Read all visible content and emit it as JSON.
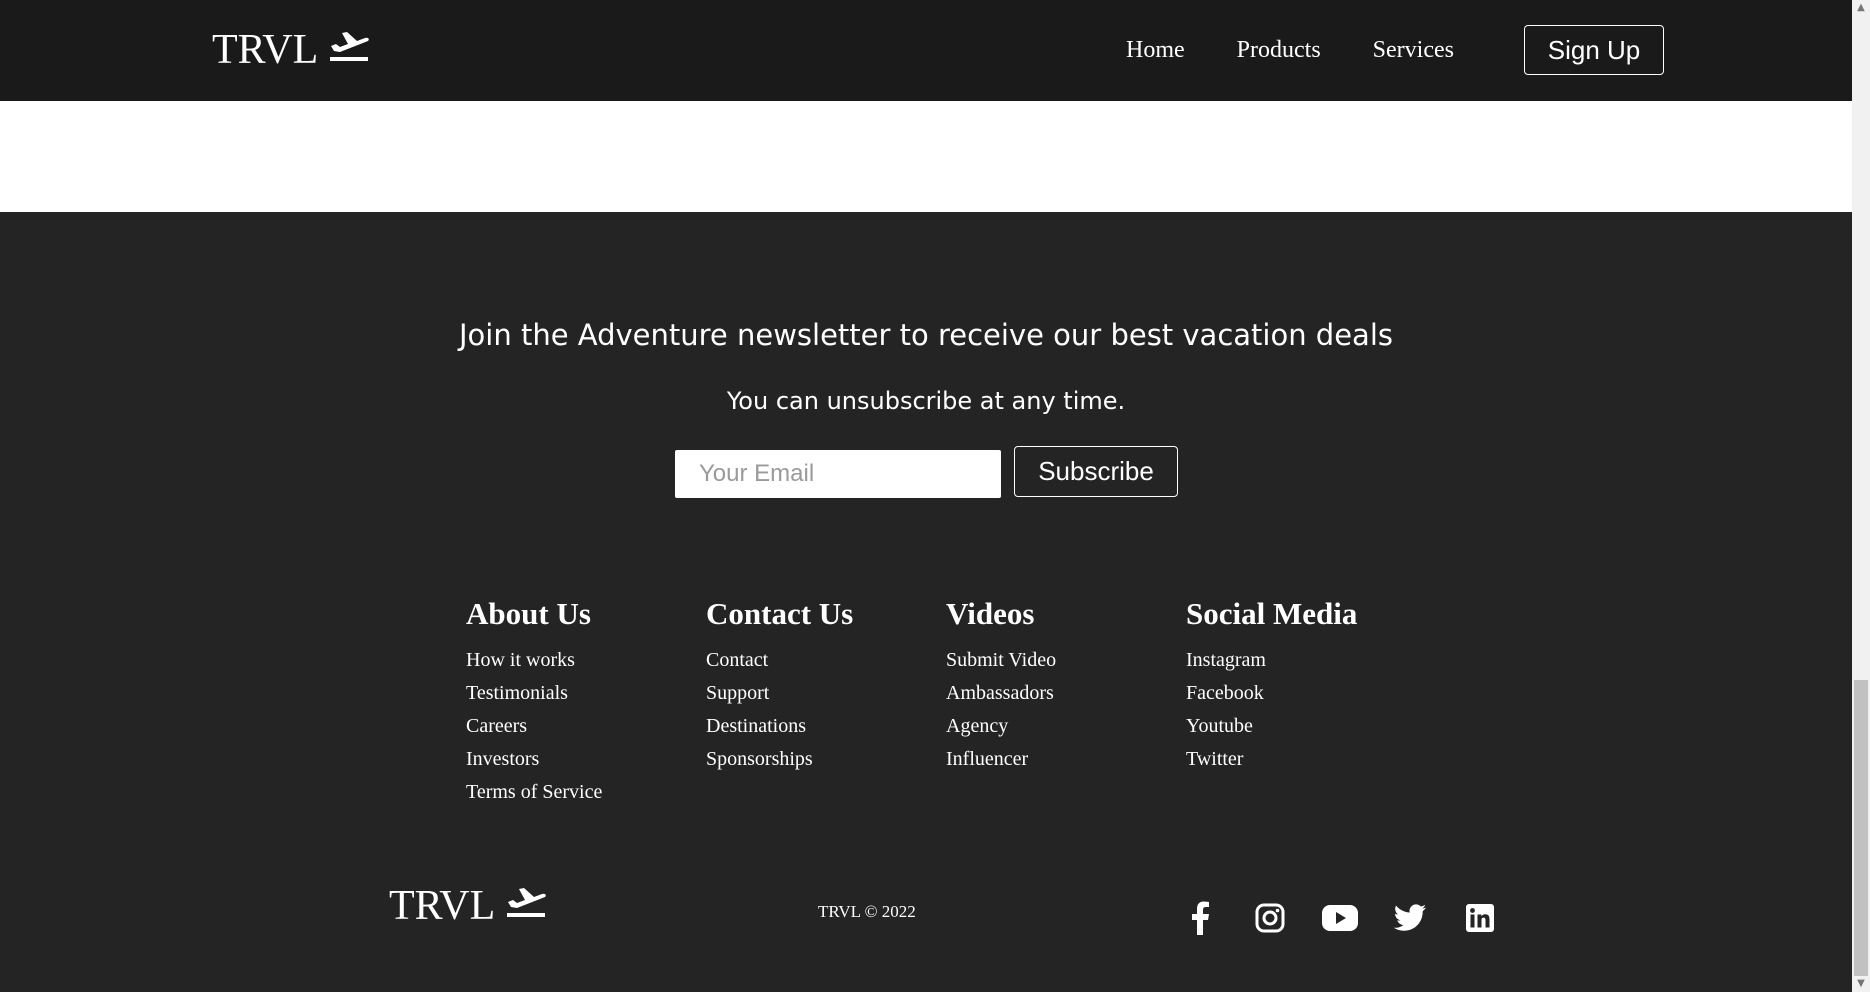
{
  "nav": {
    "logo_text": "TRVL",
    "links": [
      "Home",
      "Products",
      "Services"
    ],
    "signup_label": "Sign Up"
  },
  "newsletter": {
    "heading": "Join the Adventure newsletter to receive our best vacation deals",
    "subtext": "You can unsubscribe at any time.",
    "email_placeholder": "Your Email",
    "subscribe_label": "Subscribe"
  },
  "footer_columns": [
    {
      "title": "About Us",
      "links": [
        "How it works",
        "Testimonials",
        "Careers",
        "Investors",
        "Terms of Service"
      ]
    },
    {
      "title": "Contact Us",
      "links": [
        "Contact",
        "Support",
        "Destinations",
        "Sponsorships"
      ]
    },
    {
      "title": "Videos",
      "links": [
        "Submit Video",
        "Ambassadors",
        "Agency",
        "Influencer"
      ]
    },
    {
      "title": "Social Media",
      "links": [
        "Instagram",
        "Facebook",
        "Youtube",
        "Twitter"
      ]
    }
  ],
  "footer_bottom": {
    "logo_text": "TRVL",
    "copyright": "TRVL © 2022",
    "social_icons": [
      "facebook-icon",
      "instagram-icon",
      "youtube-icon",
      "twitter-icon",
      "linkedin-icon"
    ]
  },
  "colors": {
    "navbar_bg": "#1a1a1a",
    "footer_bg": "#242424",
    "text": "#ffffff"
  }
}
